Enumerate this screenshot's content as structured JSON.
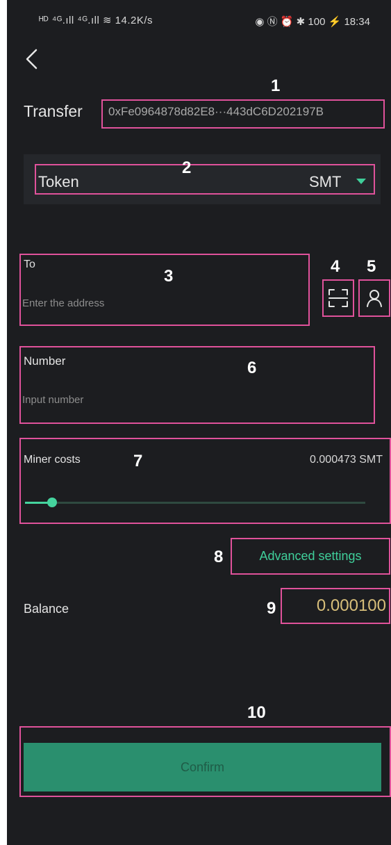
{
  "status_bar": {
    "left": "ᴴᴰ ⁴ᴳ.ıll ⁴ᴳ.ıll ≋ 14.2K/s",
    "right": "◉ Ⓝ ⏰ ✱ 100 ⚡ 18:34"
  },
  "transfer": {
    "label": "Transfer",
    "address": "0xFe0964878d82E8···443dC6D202197B"
  },
  "token": {
    "label": "Token",
    "value": "SMT",
    "accent": "#3fcf9a"
  },
  "to": {
    "label": "To",
    "placeholder": "Enter the address"
  },
  "number": {
    "label": "Number",
    "placeholder": "Input number"
  },
  "miner": {
    "label": "Miner costs",
    "value": "0.000473 SMT",
    "slider_level": 0.08
  },
  "advanced": {
    "label": "Advanced settings"
  },
  "balance": {
    "label": "Balance",
    "value": "0.000100"
  },
  "confirm": {
    "label": "Confirm"
  },
  "annotations": [
    "1",
    "2",
    "3",
    "4",
    "5",
    "6",
    "7",
    "8",
    "9",
    "10"
  ],
  "icons": {
    "back": "chevron-left-icon",
    "scan": "scan-icon",
    "contact": "contact-icon",
    "dropdown": "caret-down-icon"
  },
  "colors": {
    "background": "#1c1d20",
    "accent": "#3fcf9a",
    "balance": "#d8bf7a",
    "confirm_bg": "#2a8f6e",
    "annotation": "#e0529b"
  }
}
